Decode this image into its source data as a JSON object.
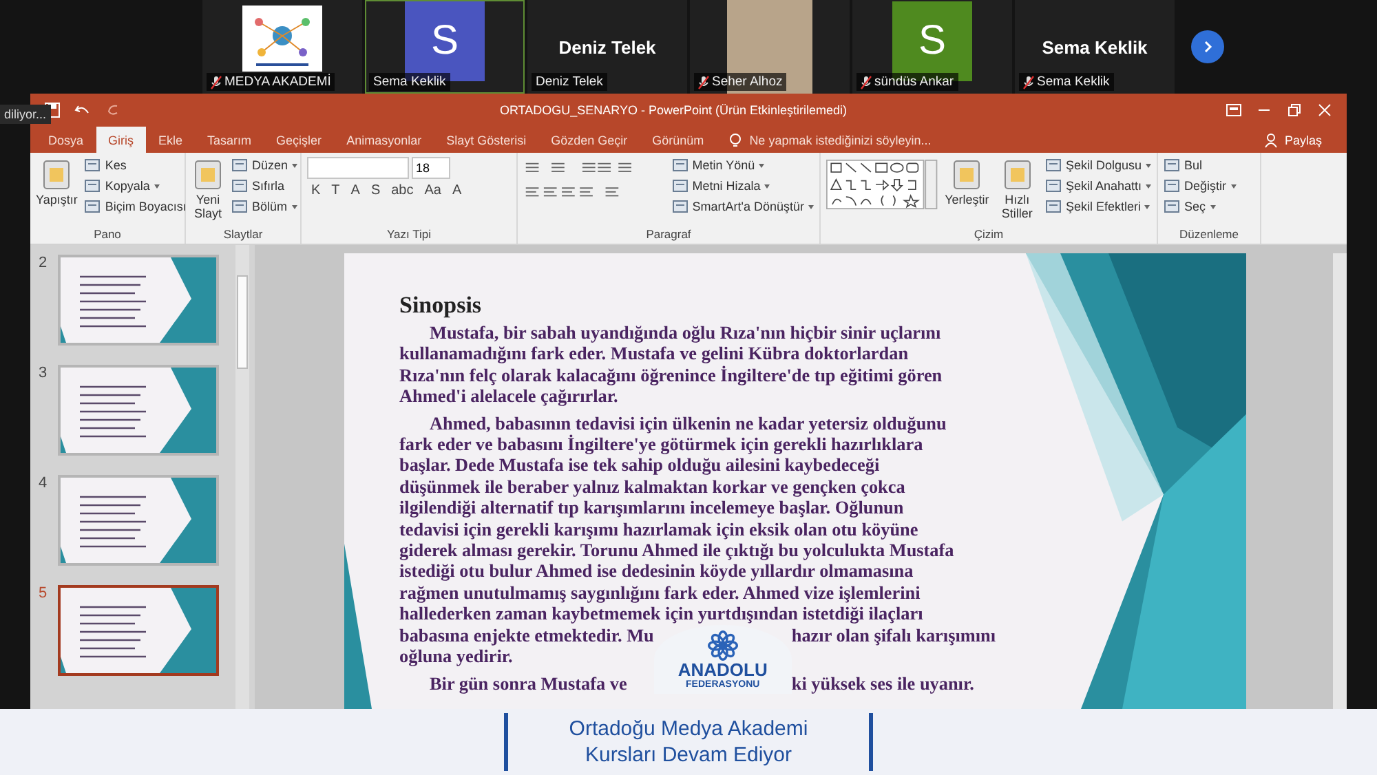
{
  "participants": [
    {
      "kind": "logo",
      "label": "MEDYA AKADEMİ",
      "muted": true,
      "selected": false
    },
    {
      "kind": "avatar",
      "letter": "S",
      "color": "#4a55bf",
      "label": "Sema Keklik",
      "muted": false,
      "selected": true
    },
    {
      "kind": "name",
      "name": "Deniz Telek",
      "label": "Deniz Telek",
      "muted": false,
      "selected": false
    },
    {
      "kind": "video",
      "label": "Seher Alhoz",
      "muted": true,
      "selected": false
    },
    {
      "kind": "avatar",
      "letter": "S",
      "color": "#4f8a1f",
      "label": "sündüs Ankar",
      "muted": true,
      "selected": false
    },
    {
      "kind": "name",
      "name": "Sema Keklik",
      "label": "Sema Keklik",
      "muted": true,
      "selected": false
    }
  ],
  "tooltip": "diliyor...",
  "window": {
    "title": "ORTADOGU_SENARYO - PowerPoint (Ürün Etkinleştirilemedi)"
  },
  "ribbon_tabs": [
    {
      "label": "Dosya",
      "selected": false
    },
    {
      "label": "Giriş",
      "selected": true
    },
    {
      "label": "Ekle",
      "selected": false
    },
    {
      "label": "Tasarım",
      "selected": false
    },
    {
      "label": "Geçişler",
      "selected": false
    },
    {
      "label": "Animasyonlar",
      "selected": false
    },
    {
      "label": "Slayt Gösterisi",
      "selected": false
    },
    {
      "label": "Gözden Geçir",
      "selected": false
    },
    {
      "label": "Görünüm",
      "selected": false
    }
  ],
  "search_hint": "Ne yapmak istediğinizi söyleyin...",
  "share": "Paylaş",
  "ribbon_groups": [
    {
      "title": "Pano",
      "items": [
        {
          "kind": "large",
          "label": "Yapıştır"
        },
        {
          "kind": "stack",
          "items": [
            {
              "label": "Kes",
              "dropdown": false
            },
            {
              "label": "Kopyala",
              "dropdown": true
            },
            {
              "label": "Biçim Boyacısı",
              "dropdown": false
            }
          ]
        }
      ]
    },
    {
      "title": "Slaytlar",
      "items": [
        {
          "kind": "large",
          "label": "Yeni Slayt"
        },
        {
          "kind": "stack",
          "items": [
            {
              "label": "Düzen",
              "dropdown": true
            },
            {
              "label": "Sıfırla",
              "dropdown": false
            },
            {
              "label": "Bölüm",
              "dropdown": true
            }
          ]
        }
      ]
    },
    {
      "title": "Yazı Tipi",
      "items": [
        {
          "kind": "font",
          "size": "18",
          "glyphs": [
            "K",
            "T",
            "A",
            "S",
            "abc",
            "Aa",
            "A"
          ]
        }
      ]
    },
    {
      "title": "Paragraf",
      "items": [
        {
          "kind": "paragraph"
        },
        {
          "kind": "stack",
          "items": [
            {
              "label": "Metin Yönü",
              "dropdown": true
            },
            {
              "label": "Metni Hizala",
              "dropdown": true
            },
            {
              "label": "SmartArt'a Dönüştür",
              "dropdown": true
            }
          ]
        }
      ]
    },
    {
      "title": "Çizim",
      "items": [
        {
          "kind": "shapes"
        },
        {
          "kind": "large",
          "label": "Yerleştir"
        },
        {
          "kind": "large",
          "label": "Hızlı Stiller"
        },
        {
          "kind": "stack",
          "items": [
            {
              "label": "Şekil Dolgusu",
              "dropdown": true
            },
            {
              "label": "Şekil Anahattı",
              "dropdown": true
            },
            {
              "label": "Şekil Efektleri",
              "dropdown": true
            }
          ]
        }
      ]
    },
    {
      "title": "Düzenleme",
      "items": [
        {
          "kind": "stack",
          "items": [
            {
              "label": "Bul",
              "dropdown": false
            },
            {
              "label": "Değiştir",
              "dropdown": true
            },
            {
              "label": "Seç",
              "dropdown": true
            }
          ]
        }
      ]
    }
  ],
  "thumbnails": [
    {
      "number": "2",
      "selected": false
    },
    {
      "number": "3",
      "selected": false
    },
    {
      "number": "4",
      "selected": false
    },
    {
      "number": "5",
      "selected": true
    }
  ],
  "slide": {
    "title": "Sinopsis",
    "paragraphs": [
      "Mustafa, bir sabah uyandığında oğlu Rıza'nın hiçbir sinir uçlarını kullanamadığını fark eder. Mustafa ve gelini Kübra doktorlardan Rıza'nın felç olarak kalacağını öğrenince İngiltere'de tıp eğitimi gören Ahmed'i alelacele çağırırlar.",
      "Ahmed, babasının tedavisi için ülkenin ne kadar yetersiz olduğunu fark eder ve babasını İngiltere'ye götürmek için gerekli hazırlıklara başlar.  Dede Mustafa ise tek sahip olduğu ailesini kaybedeceği düşünmek ile beraber yalnız kalmaktan korkar ve gençken çokca ilgilendiği alternatif tıp karışımlarını incelemeye başlar. Oğlunun tedavisi için gerekli karışımı hazırlamak için eksik olan otu köyüne giderek alması gerekir. Torunu Ahmed ile çıktığı bu yolculukta Mustafa istediği otu bulur Ahmed ise dedesinin köyde yıllardır olmamasına rağmen unutulmamış saygınlığını fark eder. Ahmed vize işlemlerini hallederken zaman kaybetmemek için yurtdışından istetdiği ilaçları"
    ],
    "covered_lines": [
      {
        "kind": "continuation",
        "left": "babasına enjekte etmektedir. Mu",
        "right": "hazır olan şifalı karışımını"
      },
      {
        "kind": "continuation",
        "left": "oğluna yedirir."
      },
      {
        "kind": "paragraph_start",
        "left": "Bir gün sonra Mustafa ve",
        "right": "ki yüksek ses ile uyanır."
      }
    ]
  },
  "logo": {
    "name": "ANADOLU",
    "subtitle": "FEDERASYONU"
  },
  "caption_lines": [
    "Ortadoğu Medya Akademi",
    "Kursları Devam Ediyor"
  ]
}
